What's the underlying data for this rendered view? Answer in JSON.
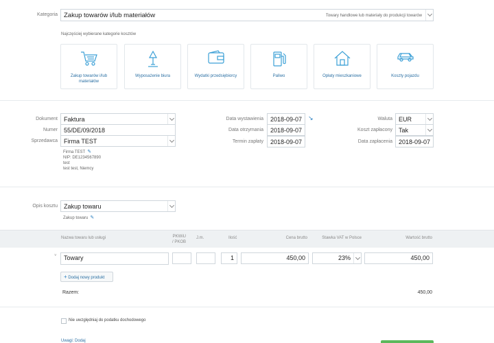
{
  "category": {
    "label": "Kategoria",
    "value": "Zakup towarów i/lub materiałów",
    "hint": "Towary handlowe lub materiały do produkcji towarów",
    "recent_heading": "Najczęściej wybierane kategorie kosztów",
    "cards": [
      {
        "label": "Zakup towarów i/lub materiałów",
        "icon": "cart-icon"
      },
      {
        "label": "Wyposażenie biura",
        "icon": "desk-lamp-icon"
      },
      {
        "label": "Wydatki przedsiębiorcy",
        "icon": "wallet-icon"
      },
      {
        "label": "Paliwo",
        "icon": "fuel-pump-icon"
      },
      {
        "label": "Opłaty mieszkaniowe",
        "icon": "house-icon"
      },
      {
        "label": "Koszty pojazdu",
        "icon": "car-icon"
      }
    ]
  },
  "document": {
    "doc_label": "Dokument",
    "doc_value": "Faktura",
    "number_label": "Numer",
    "number_value": "55/DE/09/2018",
    "seller_label": "Sprzedawca",
    "seller_value": "Firma TEST",
    "seller_details": [
      "Firma TEST",
      "NIP: DE1234567890",
      "test",
      "test test, Niemcy"
    ],
    "issue_label": "Data wystawienia",
    "issue_value": "2018-09-07",
    "received_label": "Data otrzymania",
    "received_value": "2018-09-07",
    "due_label": "Termin zapłaty",
    "due_value": "2018-09-07",
    "currency_label": "Waluta",
    "currency_value": "EUR",
    "paid_label": "Koszt zapłacony",
    "paid_value": "Tak",
    "paid_date_label": "Data zapłacenia",
    "paid_date_value": "2018-09-07"
  },
  "cost_description": {
    "label": "Opis kosztu",
    "value": "Zakup towaru",
    "note": "Zakup towaru"
  },
  "items_table": {
    "headers": {
      "name": "Nazwa towaru lub usługi",
      "pkwiu_line1": "PKWiU",
      "pkwiu_line2": "/ PKOB",
      "unit": "J.m.",
      "qty": "Ilość",
      "gross_price": "Cena brutto",
      "vat_rate": "Stawka VAT w Polsce",
      "gross_value": "Wartość brutto"
    },
    "rows": [
      {
        "name": "Towary",
        "pkwiu": "",
        "unit": "",
        "qty": "1",
        "gross_price": "450,00",
        "vat_rate": "23%",
        "gross_value": "450,00"
      }
    ],
    "add_button": "Dodaj nowy produkt",
    "total_label": "Razem:",
    "total_value": "450,00"
  },
  "income_tax": {
    "checkbox_label": "Nie uwzględniaj do podatku dochodowego"
  },
  "footer": {
    "notes_link": "Uwagi: Dodaj"
  },
  "colors": {
    "accent": "#2a7fc0",
    "icon": "#3a9fd6",
    "save_button": "#5cb85c"
  }
}
